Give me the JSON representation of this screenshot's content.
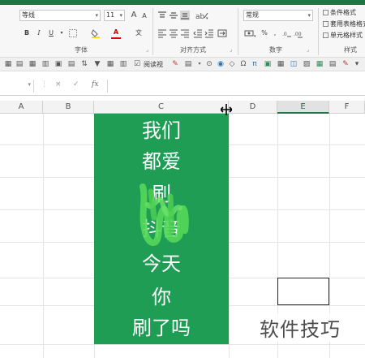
{
  "ribbon": {
    "font": {
      "name": "等线",
      "size": "11",
      "group_label": "字体",
      "bold": "B",
      "italic": "I",
      "underline": "U",
      "grow": "A",
      "shrink": "A",
      "font_color_glyph": "A",
      "phonetic": "文"
    },
    "alignment": {
      "group_label": "对齐方式"
    },
    "number": {
      "format": "常规",
      "group_label": "数字",
      "percent": "%",
      "comma": ","
    },
    "styles": {
      "group_label": "样式",
      "items": [
        "条件格式",
        "套用表格格式",
        "单元格样式"
      ]
    }
  },
  "qat": {
    "label": "阅读视"
  },
  "formula_bar": {
    "cancel": "×",
    "confirm": "✓",
    "fx": "fx"
  },
  "columns": [
    "A",
    "B",
    "C",
    "D",
    "E",
    "F"
  ],
  "selected_column": "E",
  "cell_lines": [
    "我们",
    "都爱",
    "刷",
    "抖音",
    "今天",
    "你",
    "刷了吗"
  ],
  "watermark": "软件技巧",
  "colors": {
    "accent": "#217346",
    "cell_fill": "#1f9d55",
    "scribble": "#55d85a"
  }
}
